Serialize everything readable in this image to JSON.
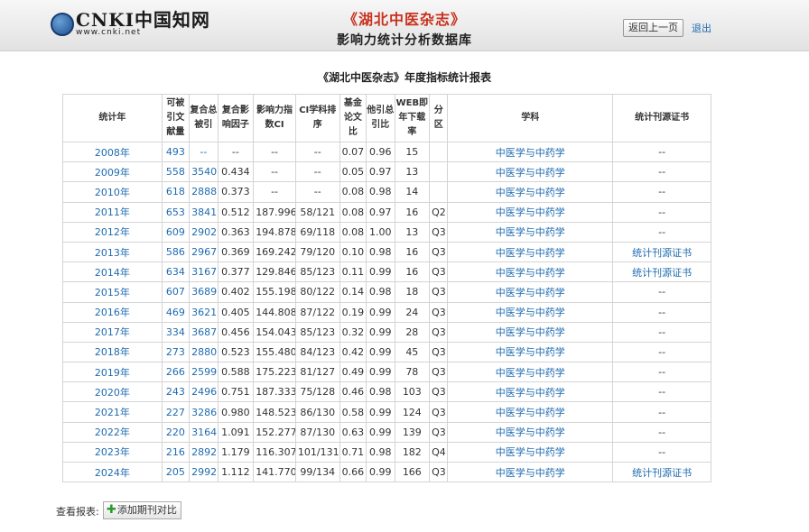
{
  "header": {
    "logo_main": "CNKI中国知网",
    "logo_url": "www.cnki.net",
    "journal_name": "《湖北中医杂志》",
    "db_name": "影响力统计分析数据库",
    "back_label": "返回上一页",
    "exit_label": "退出"
  },
  "report": {
    "title": "《湖北中医杂志》年度指标统计报表",
    "columns": [
      "统计年",
      "可被引文献量",
      "复合总被引",
      "复合影响因子",
      "影响力指数CI",
      "CI学科排序",
      "基金论文比",
      "他引总引比",
      "WEB即年下载率",
      "分区",
      "学科",
      "统计刊源证书"
    ],
    "rows": [
      {
        "year": "2008年",
        "citable": "493",
        "total_cites": "--",
        "impact_factor": "--",
        "ci": "--",
        "ci_rank": "--",
        "fund_ratio": "0.07",
        "other_cite_ratio": "0.96",
        "web_rate": "15",
        "zone": "",
        "subject": "中医学与中药学",
        "cert": "--"
      },
      {
        "year": "2009年",
        "citable": "558",
        "total_cites": "3540",
        "impact_factor": "0.434",
        "ci": "--",
        "ci_rank": "--",
        "fund_ratio": "0.05",
        "other_cite_ratio": "0.97",
        "web_rate": "13",
        "zone": "",
        "subject": "中医学与中药学",
        "cert": "--"
      },
      {
        "year": "2010年",
        "citable": "618",
        "total_cites": "2888",
        "impact_factor": "0.373",
        "ci": "--",
        "ci_rank": "--",
        "fund_ratio": "0.08",
        "other_cite_ratio": "0.98",
        "web_rate": "14",
        "zone": "",
        "subject": "中医学与中药学",
        "cert": "--"
      },
      {
        "year": "2011年",
        "citable": "653",
        "total_cites": "3841",
        "impact_factor": "0.512",
        "ci": "187.996",
        "ci_rank": "58/121",
        "fund_ratio": "0.08",
        "other_cite_ratio": "0.97",
        "web_rate": "16",
        "zone": "Q2",
        "subject": "中医学与中药学",
        "cert": "--"
      },
      {
        "year": "2012年",
        "citable": "609",
        "total_cites": "2902",
        "impact_factor": "0.363",
        "ci": "194.878",
        "ci_rank": "69/118",
        "fund_ratio": "0.08",
        "other_cite_ratio": "1.00",
        "web_rate": "13",
        "zone": "Q3",
        "subject": "中医学与中药学",
        "cert": "--"
      },
      {
        "year": "2013年",
        "citable": "586",
        "total_cites": "2967",
        "impact_factor": "0.369",
        "ci": "169.242",
        "ci_rank": "79/120",
        "fund_ratio": "0.10",
        "other_cite_ratio": "0.98",
        "web_rate": "16",
        "zone": "Q3",
        "subject": "中医学与中药学",
        "cert": "统计刊源证书"
      },
      {
        "year": "2014年",
        "citable": "634",
        "total_cites": "3167",
        "impact_factor": "0.377",
        "ci": "129.846",
        "ci_rank": "85/123",
        "fund_ratio": "0.11",
        "other_cite_ratio": "0.99",
        "web_rate": "16",
        "zone": "Q3",
        "subject": "中医学与中药学",
        "cert": "统计刊源证书"
      },
      {
        "year": "2015年",
        "citable": "607",
        "total_cites": "3689",
        "impact_factor": "0.402",
        "ci": "155.198",
        "ci_rank": "80/122",
        "fund_ratio": "0.14",
        "other_cite_ratio": "0.98",
        "web_rate": "18",
        "zone": "Q3",
        "subject": "中医学与中药学",
        "cert": "--"
      },
      {
        "year": "2016年",
        "citable": "469",
        "total_cites": "3621",
        "impact_factor": "0.405",
        "ci": "144.808",
        "ci_rank": "87/122",
        "fund_ratio": "0.19",
        "other_cite_ratio": "0.99",
        "web_rate": "24",
        "zone": "Q3",
        "subject": "中医学与中药学",
        "cert": "--"
      },
      {
        "year": "2017年",
        "citable": "334",
        "total_cites": "3687",
        "impact_factor": "0.456",
        "ci": "154.043",
        "ci_rank": "85/123",
        "fund_ratio": "0.32",
        "other_cite_ratio": "0.99",
        "web_rate": "28",
        "zone": "Q3",
        "subject": "中医学与中药学",
        "cert": "--"
      },
      {
        "year": "2018年",
        "citable": "273",
        "total_cites": "2880",
        "impact_factor": "0.523",
        "ci": "155.480",
        "ci_rank": "84/123",
        "fund_ratio": "0.42",
        "other_cite_ratio": "0.99",
        "web_rate": "45",
        "zone": "Q3",
        "subject": "中医学与中药学",
        "cert": "--"
      },
      {
        "year": "2019年",
        "citable": "266",
        "total_cites": "2599",
        "impact_factor": "0.588",
        "ci": "175.223",
        "ci_rank": "81/127",
        "fund_ratio": "0.49",
        "other_cite_ratio": "0.99",
        "web_rate": "78",
        "zone": "Q3",
        "subject": "中医学与中药学",
        "cert": "--"
      },
      {
        "year": "2020年",
        "citable": "243",
        "total_cites": "2496",
        "impact_factor": "0.751",
        "ci": "187.333",
        "ci_rank": "75/128",
        "fund_ratio": "0.46",
        "other_cite_ratio": "0.98",
        "web_rate": "103",
        "zone": "Q3",
        "subject": "中医学与中药学",
        "cert": "--"
      },
      {
        "year": "2021年",
        "citable": "227",
        "total_cites": "3286",
        "impact_factor": "0.980",
        "ci": "148.523",
        "ci_rank": "86/130",
        "fund_ratio": "0.58",
        "other_cite_ratio": "0.99",
        "web_rate": "124",
        "zone": "Q3",
        "subject": "中医学与中药学",
        "cert": "--"
      },
      {
        "year": "2022年",
        "citable": "220",
        "total_cites": "3164",
        "impact_factor": "1.091",
        "ci": "152.277",
        "ci_rank": "87/130",
        "fund_ratio": "0.63",
        "other_cite_ratio": "0.99",
        "web_rate": "139",
        "zone": "Q3",
        "subject": "中医学与中药学",
        "cert": "--"
      },
      {
        "year": "2023年",
        "citable": "216",
        "total_cites": "2892",
        "impact_factor": "1.179",
        "ci": "116.307",
        "ci_rank": "101/131",
        "fund_ratio": "0.71",
        "other_cite_ratio": "0.98",
        "web_rate": "182",
        "zone": "Q4",
        "subject": "中医学与中药学",
        "cert": "--"
      },
      {
        "year": "2024年",
        "citable": "205",
        "total_cites": "2992",
        "impact_factor": "1.112",
        "ci": "141.770",
        "ci_rank": "99/134",
        "fund_ratio": "0.66",
        "other_cite_ratio": "0.99",
        "web_rate": "166",
        "zone": "Q3",
        "subject": "中医学与中药学",
        "cert": "统计刊源证书"
      }
    ]
  },
  "footer": {
    "view_label": "查看报表:",
    "add_compare_label": "添加期刊对比"
  },
  "colors": {
    "link": "#1f6bb0",
    "journal_red": "#c8321e",
    "plus_green": "#2a9a2a"
  }
}
